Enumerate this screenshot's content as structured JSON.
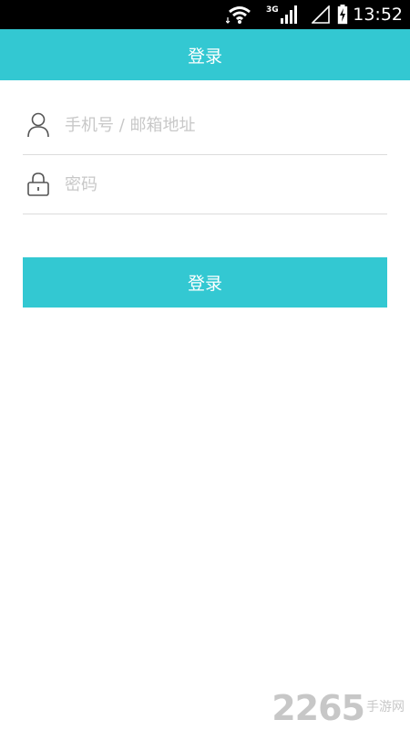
{
  "status_bar": {
    "network_label": "3G",
    "time": "13:52",
    "icons": [
      "wifi-icon",
      "cellular-signal-icon",
      "signal-empty-icon",
      "battery-charging-icon"
    ]
  },
  "header": {
    "title": "登录"
  },
  "form": {
    "account_placeholder": "手机号 / 邮箱地址",
    "account_value": "",
    "password_placeholder": "密码",
    "password_value": "",
    "account_icon": "user-icon",
    "password_icon": "lock-icon"
  },
  "login_button": {
    "label": "登录"
  },
  "watermark": {
    "number": "2265",
    "text": "手游网"
  },
  "colors": {
    "accent": "#33c8d2",
    "status_bar": "#000000",
    "divider": "#dcdcdc",
    "placeholder": "#c8c8c8"
  }
}
